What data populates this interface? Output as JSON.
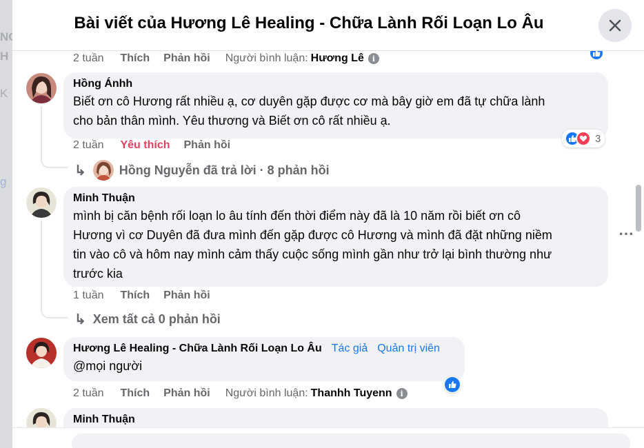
{
  "dialog": {
    "title": "Bài viết của Hương Lê Healing - Chữa Lành Rối Loạn Lo Âu"
  },
  "backdrop": {
    "fragments": [
      "NG",
      "H",
      "K",
      "g"
    ]
  },
  "comments": [
    {
      "time": "2 tuần",
      "like_label": "Thích",
      "reply_label": "Phản hồi",
      "commenter_prefix": "Người bình luận:",
      "commenter_name": "Hương Lê"
    },
    {
      "author": "Hồng Ánhh",
      "text_line1": "Biết ơn cô Hương rất nhiều ạ, cơ duyên gặp được cơ mà bây giờ em đã tự chữa lành",
      "text_line2": "cho bản thân mình. Yêu thương và Biết ơn cô rất nhiều ạ.",
      "time": "2 tuần",
      "reaction_label": "Yêu thích",
      "reply_label": "Phản hồi",
      "reaction_count": "3",
      "replies_text": "Hồng Nguyễn đã trả lời · 8 phản hồi"
    },
    {
      "author": "Minh Thuận",
      "text_line1": "mình bị căn bệnh rối loạn lo âu tính đến thời điểm này đã là 10 năm rồi biết ơn cô",
      "text_line2": "Hương vì cơ Duyên đã đưa mình đến gặp được cô Hương và mình đã đặt những niềm",
      "text_line3": "tin vào cô và hôm nay mình cảm thấy cuộc sống mình gần như trở lại bình thường như",
      "text_line4": "trước kia",
      "time": "1 tuần",
      "like_label": "Thích",
      "reply_label": "Phản hồi",
      "replies_text": "Xem tất cả 0 phản hồi",
      "more_icon": "⋯"
    },
    {
      "author": "Hương Lê Healing - Chữa Lành Rối Loạn Lo Âu",
      "tag_author": "Tác giả",
      "tag_admin": "Quản trị viên",
      "text": "@mọi người",
      "time": "2 tuần",
      "like_label": "Thích",
      "reply_label": "Phản hồi",
      "commenter_prefix": "Người bình luận:",
      "commenter_name": "Thanhh Tuyenn"
    },
    {
      "author": "Minh Thuận"
    }
  ],
  "colors": {
    "like_blue": "#1877f2",
    "love_red": "#f33e58",
    "love_text": "#e4405f",
    "secondary_text": "#65676b",
    "bubble_bg": "#f0f2f5"
  }
}
